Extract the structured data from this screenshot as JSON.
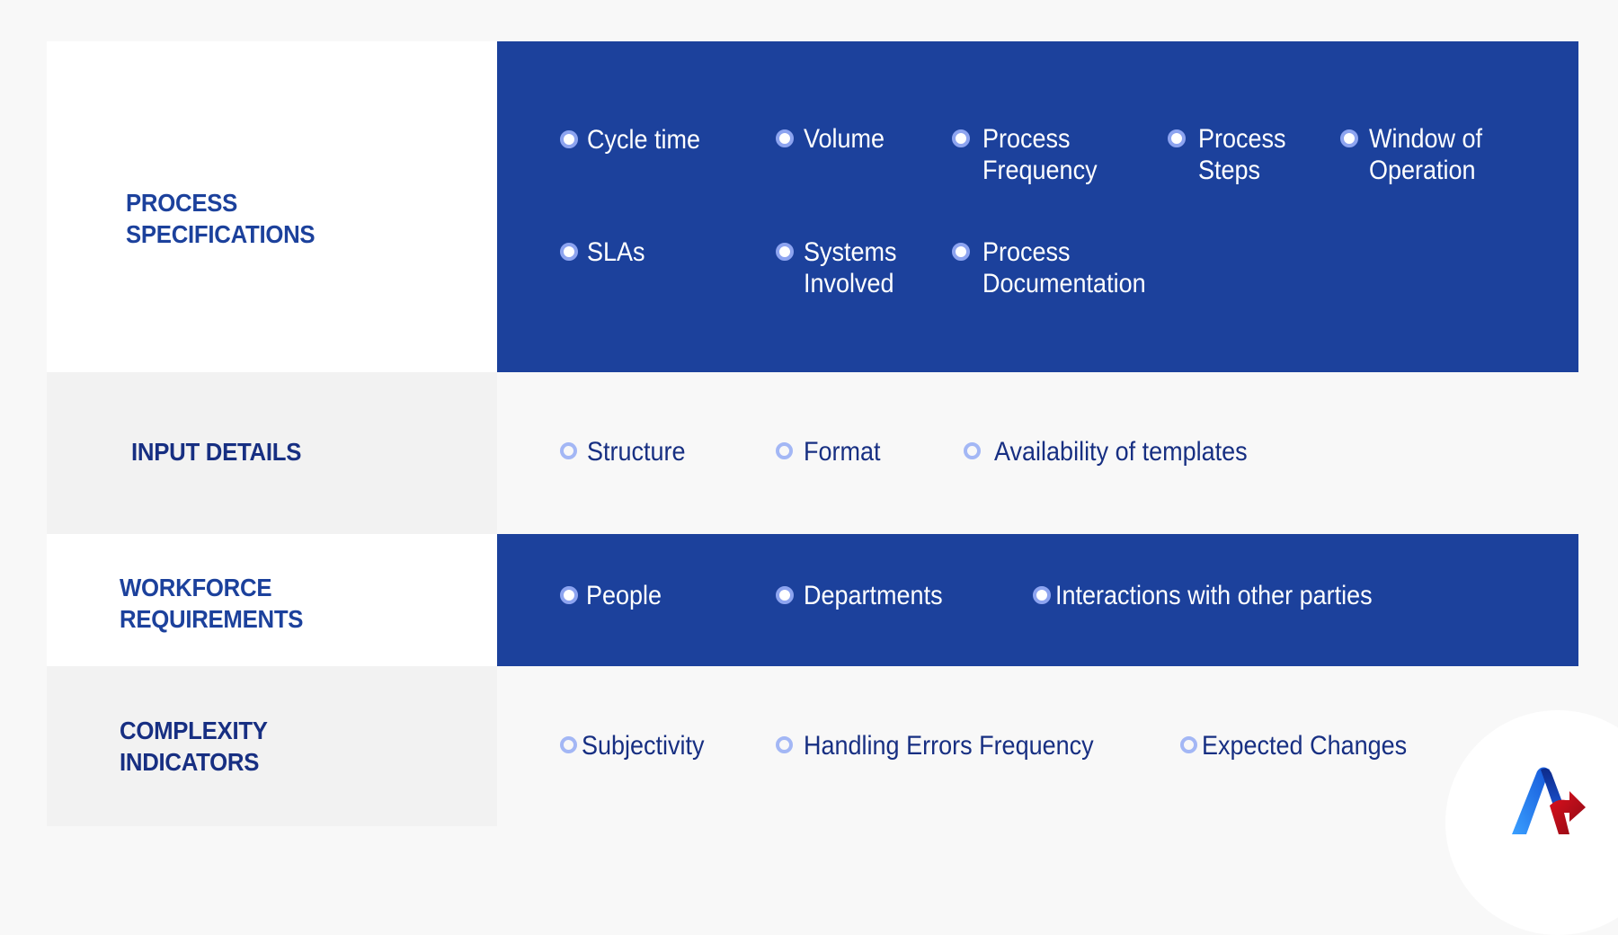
{
  "rows": [
    {
      "heading": [
        "PROCESS",
        "SPECIFICATIONS"
      ],
      "items": [
        {
          "lines": [
            "Cycle time"
          ]
        },
        {
          "lines": [
            "Volume"
          ]
        },
        {
          "lines": [
            "Process",
            "Frequency"
          ]
        },
        {
          "lines": [
            "Process",
            "Steps"
          ]
        },
        {
          "lines": [
            "Window of",
            "Operation"
          ]
        },
        {
          "lines": [
            "SLAs"
          ]
        },
        {
          "lines": [
            "Systems",
            "Involved"
          ]
        },
        {
          "lines": [
            "Process",
            "Documentation"
          ]
        }
      ]
    },
    {
      "heading": [
        "INPUT DETAILS"
      ],
      "items": [
        {
          "lines": [
            "Structure"
          ]
        },
        {
          "lines": [
            "Format"
          ]
        },
        {
          "lines": [
            "Availability of templates"
          ]
        }
      ]
    },
    {
      "heading": [
        "WORKFORCE",
        "REQUIREMENTS"
      ],
      "items": [
        {
          "lines": [
            "People"
          ]
        },
        {
          "lines": [
            "Departments"
          ]
        },
        {
          "lines": [
            "Interactions with other parties"
          ]
        }
      ]
    },
    {
      "heading": [
        "COMPLEXITY",
        "INDICATORS"
      ],
      "items": [
        {
          "lines": [
            "Subjectivity"
          ]
        },
        {
          "lines": [
            "Handling Errors Frequency"
          ]
        },
        {
          "lines": [
            "Expected Changes"
          ]
        }
      ]
    }
  ],
  "colors": {
    "primary_blue": "#1c419c",
    "navy_text": "#172f82",
    "bullet_light": "#8da4f0",
    "logo_blue": "#1f6fe0",
    "logo_red": "#d0101e"
  },
  "logo": {
    "icon": "brand-logo-icon"
  }
}
